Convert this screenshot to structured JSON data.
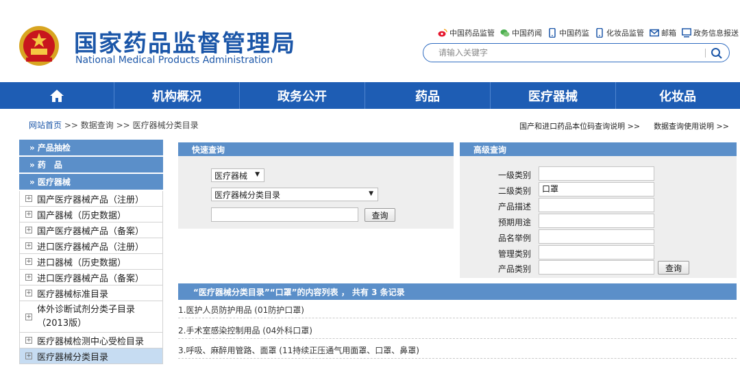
{
  "site": {
    "title_cn": "国家药品监督管理局",
    "title_en": "National Medical Products Administration"
  },
  "toplinks": [
    {
      "label": "中国药品监管",
      "icon": "weibo-icon",
      "color": "#e6162d"
    },
    {
      "label": "中国药闻",
      "icon": "wechat-icon",
      "color": "#4caf50"
    },
    {
      "label": "中国药监",
      "icon": "mobile-icon",
      "color": "#1b56a8"
    },
    {
      "label": "化妆品监管",
      "icon": "mobile-icon",
      "color": "#1b56a8"
    },
    {
      "label": "邮箱",
      "icon": "mail-icon",
      "color": "#1b56a8"
    },
    {
      "label": "政务信息报送",
      "icon": "monitor-icon",
      "color": "#1b56a8"
    }
  ],
  "search": {
    "placeholder": "请输入关键字"
  },
  "nav": [
    "机构概况",
    "政务公开",
    "药品",
    "医疗器械",
    "化妆品"
  ],
  "breadcrumb": {
    "home": "网站首页",
    "sep1": ">>",
    "level2": "数据查询",
    "sep2": ">>",
    "level3": "医疗器械分类目录"
  },
  "right_links": [
    "国产和进口药品本位码查询说明 >>",
    "数据查询使用说明 >>"
  ],
  "sidebar": {
    "heads": [
      "» 产品抽检",
      "» 药　品",
      "» 医疗器械"
    ],
    "items": [
      "国产医疗器械产品（注册）",
      "国产器械（历史数据）",
      "国产医疗器械产品（备案）",
      "进口医疗器械产品（注册）",
      "进口器械（历史数据）",
      "进口医疗器械产品（备案）",
      "医疗器械标准目录",
      "体外诊断试剂分类子目录（2013版）",
      "医疗器械检测中心受检目录",
      "医疗器械分类目录"
    ]
  },
  "quick": {
    "title": "快速查询",
    "select1": "医疗器械",
    "select2": "医疗器械分类目录",
    "query_btn": "查询"
  },
  "advanced": {
    "title": "高级查询",
    "fields": [
      {
        "label": "一级类别",
        "value": ""
      },
      {
        "label": "二级类别",
        "value": "口罩"
      },
      {
        "label": "产品描述",
        "value": ""
      },
      {
        "label": "预期用途",
        "value": ""
      },
      {
        "label": "品名举例",
        "value": ""
      },
      {
        "label": "管理类别",
        "value": ""
      },
      {
        "label": "产品类别",
        "value": ""
      }
    ],
    "query_btn": "查询"
  },
  "results": {
    "header": "“医疗器械分类目录”“口罩”的内容列表 ，  共有 3 条记录",
    "rows": [
      "1.医护人员防护用品 (01防护口罩)",
      "2.手术室感染控制用品 (04外科口罩)",
      "3.呼吸、麻醉用管路、面罩 (11持续正压通气用面罩、口罩、鼻罩)"
    ]
  }
}
